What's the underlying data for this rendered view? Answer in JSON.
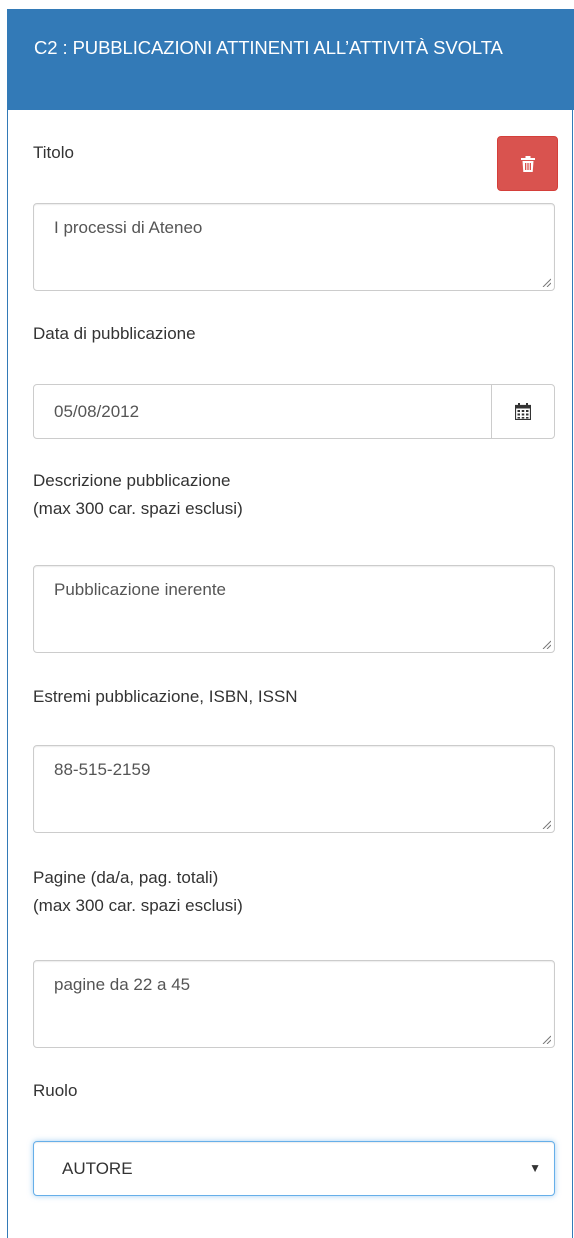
{
  "panel": {
    "title": "C2 : PUBBLICAZIONI ATTINENTI ALL’ATTIVITÀ SVOLTA"
  },
  "fields": {
    "titolo": {
      "label": "Titolo",
      "value": "I processi di Ateneo"
    },
    "data": {
      "label": "Data di pubblicazione",
      "value": "05/08/2012"
    },
    "descrizione": {
      "label_line1": "Descrizione pubblicazione",
      "label_line2": "(max 300 car. spazi esclusi)",
      "value": "Pubblicazione inerente"
    },
    "estremi": {
      "label": "Estremi pubblicazione, ISBN, ISSN",
      "value": "88-515-2159"
    },
    "pagine": {
      "label_line1": "Pagine (da/a, pag. totali)",
      "label_line2": "(max 300 car. spazi esclusi)",
      "value": "pagine da 22 a 45"
    },
    "ruolo": {
      "label": "Ruolo",
      "selected": "AUTORE"
    }
  },
  "icons": {
    "delete": "trash-icon",
    "calendar": "calendar-icon",
    "select_arrow": "▼"
  },
  "colors": {
    "header": "#337ab7",
    "danger": "#d9534f",
    "focus": "#66afe9"
  }
}
